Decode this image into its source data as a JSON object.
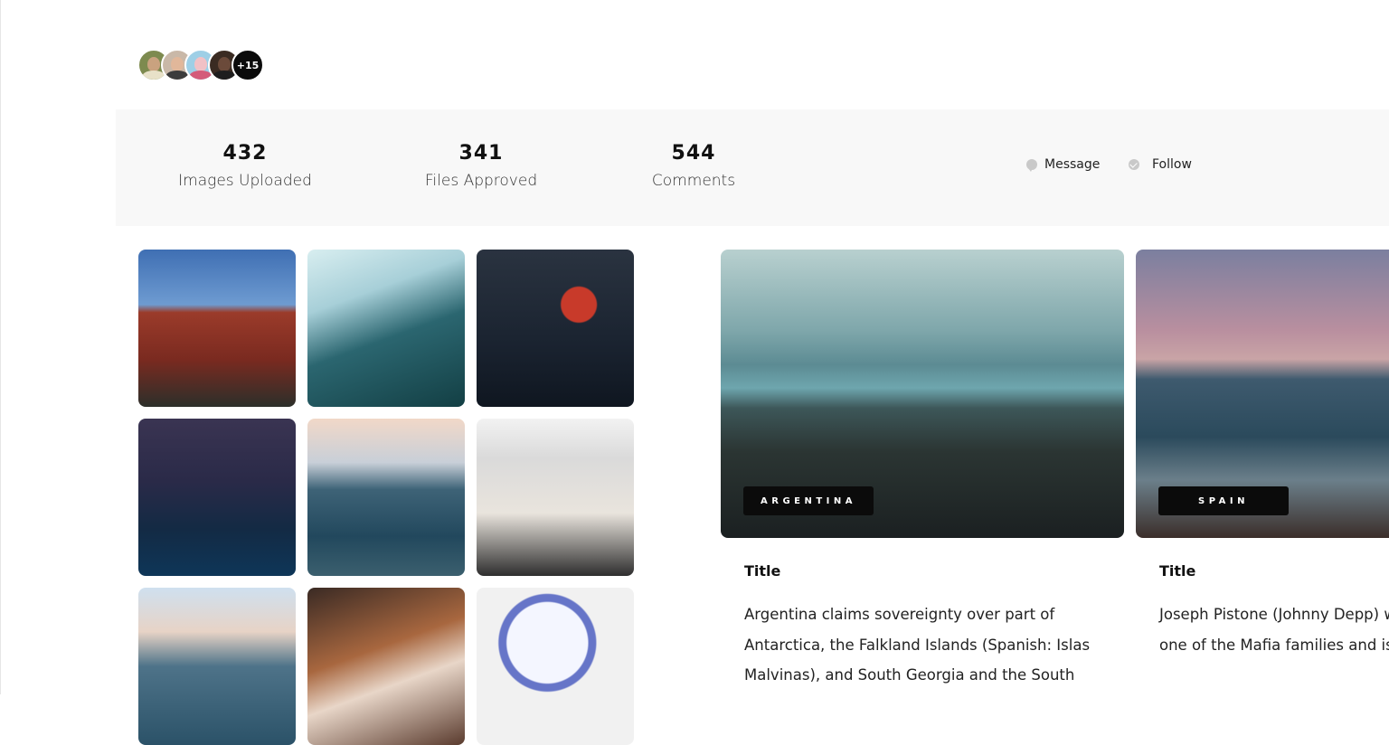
{
  "avatars": {
    "more_label": "+15",
    "items": [
      {
        "face": "#c9a27f",
        "bg": "#7d8a4f",
        "shoulders": "#e8e1c8"
      },
      {
        "face": "#e1b79a",
        "bg": "#c9b8a8",
        "shoulders": "#3c3c3c"
      },
      {
        "face": "#f1c1c6",
        "bg": "#9ecfe6",
        "shoulders": "#d45b7a"
      },
      {
        "face": "#6b4a3a",
        "bg": "#3a2b22",
        "shoulders": "#1e1e1e"
      }
    ]
  },
  "stats": [
    {
      "value": "432",
      "label": "Images Uploaded"
    },
    {
      "value": "341",
      "label": "Files Approved"
    },
    {
      "value": "544",
      "label": "Comments"
    }
  ],
  "actions": {
    "message_label": "Message",
    "follow_label": "Follow"
  },
  "grid": {
    "tiles": [
      {
        "alt": "street-buildings"
      },
      {
        "alt": "escalator"
      },
      {
        "alt": "basket"
      },
      {
        "alt": "city-skyline"
      },
      {
        "alt": "coast-waves"
      },
      {
        "alt": "two-women"
      },
      {
        "alt": "coast-beach"
      },
      {
        "alt": "woman-curly-hair"
      },
      {
        "alt": "bowl-blueberries"
      }
    ]
  },
  "cards": [
    {
      "badge": "ARGENTINA",
      "title": "Title",
      "text": "Argentina claims sovereignty over part of Antarctica, the Falkland Islands (Spanish: Islas Malvinas), and South Georgia and the South"
    },
    {
      "badge": "SPAIN",
      "title": "Title",
      "text": "Joseph Pistone (Johnny Depp) who has infiltrated one of the Mafia families and is living und"
    }
  ],
  "colors": {
    "stats_bg": "#f8f8f8",
    "badge_bg": "#0b0b0b",
    "icon_gray": "#c9c9c9"
  }
}
